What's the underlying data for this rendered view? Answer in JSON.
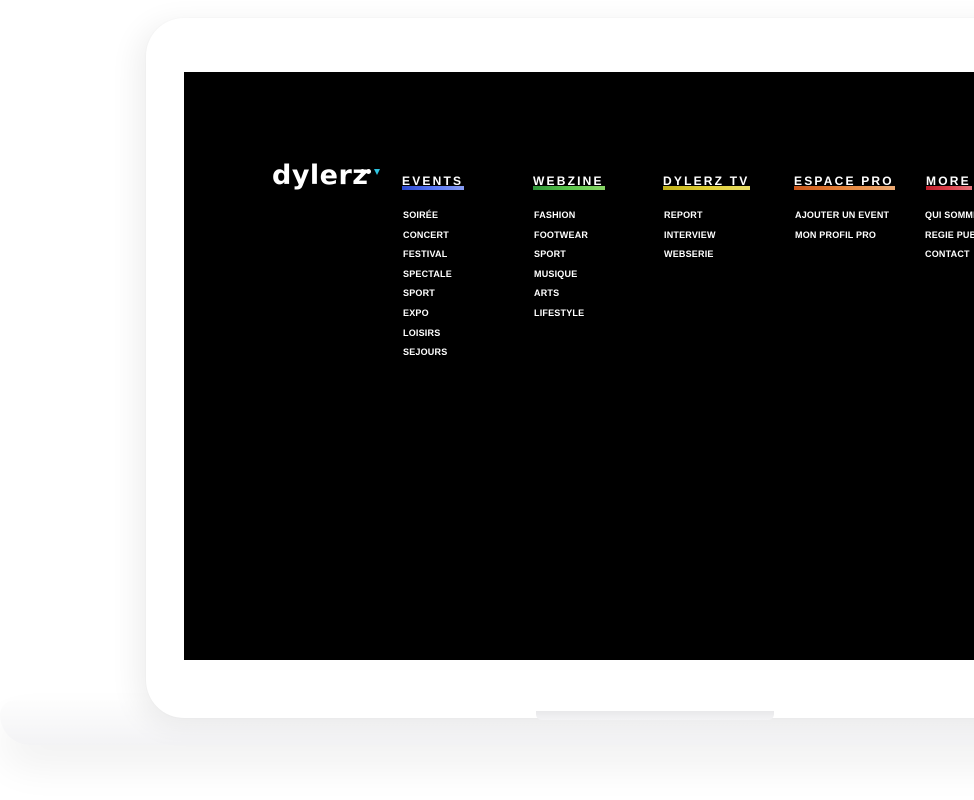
{
  "logo": {
    "text": "dylerz",
    "accent_color": "#2ec4e0"
  },
  "menu": [
    {
      "heading": "EVENTS",
      "underline_gradient": [
        "#2d4bd8",
        "#5a7bff",
        "#8fa4ff"
      ],
      "items": [
        "SOIRÉE",
        "CONCERT",
        "FESTIVAL",
        "SPECTALE",
        "SPORT",
        "EXPO",
        "LOISIRS",
        "SEJOURS"
      ]
    },
    {
      "heading": "WEBZINE",
      "underline_gradient": [
        "#2f9a3a",
        "#5fcf4f",
        "#8fe06a"
      ],
      "items": [
        "FASHION",
        "FOOTWEAR",
        "SPORT",
        "MUSIQUE",
        "ARTS",
        "LIFESTYLE"
      ]
    },
    {
      "heading": "DYLERZ TV",
      "underline_gradient": [
        "#c9b91c",
        "#ecd935",
        "#f3e86c"
      ],
      "items": [
        "REPORT",
        "INTERVIEW",
        "WEBSERIE"
      ]
    },
    {
      "heading": "ESPACE PRO",
      "underline_gradient": [
        "#d45a1c",
        "#f08a3c",
        "#f7b27a"
      ],
      "items": [
        "AJOUTER UN EVENT",
        "MON PROFIL PRO"
      ]
    },
    {
      "heading": "MORE",
      "underline_gradient": [
        "#c81e2c",
        "#e8454f",
        "#f27b83"
      ],
      "items": [
        "QUI SOMMES NOUS",
        "REGIE PUBLICITAIRE",
        "CONTACT"
      ]
    }
  ]
}
